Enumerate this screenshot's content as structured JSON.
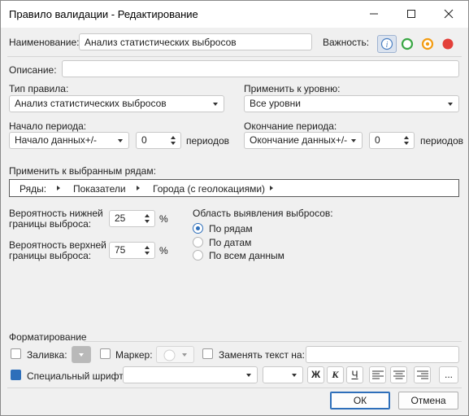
{
  "window": {
    "title": "Правило валидации - Редактирование"
  },
  "name": {
    "label": "Наименование:",
    "value": "Анализ статистических выбросов"
  },
  "importance": {
    "label": "Важность:",
    "options": [
      "info-icon",
      "green-circle-icon",
      "orange-circle-icon",
      "red-circle-icon"
    ],
    "colors": {
      "green": "#3aa745",
      "orange": "#f39c12",
      "red": "#e3403a",
      "info": "#4a7fc1"
    }
  },
  "description": {
    "label": "Описание:",
    "value": ""
  },
  "rule_type": {
    "label": "Тип правила:",
    "value": "Анализ статистических выбросов"
  },
  "apply_level": {
    "label": "Применить к уровню:",
    "value": "Все уровни"
  },
  "period_start": {
    "label": "Начало периода:",
    "mode": "Начало данных+/-",
    "count": "0",
    "unit": "периодов"
  },
  "period_end": {
    "label": "Окончание периода:",
    "mode": "Окончание данных+/-",
    "count": "0",
    "unit": "периодов"
  },
  "rows": {
    "label": "Применить к выбранным рядам:",
    "crumbs": [
      "Ряды:",
      "Показатели",
      "Города (с геолокациями)"
    ]
  },
  "lower": {
    "label_line1": "Вероятность нижней",
    "label_line2": "границы выброса:",
    "value": "25",
    "unit": "%"
  },
  "upper": {
    "label_line1": "Вероятность верхней",
    "label_line2": "границы выброса:",
    "value": "75",
    "unit": "%"
  },
  "scope": {
    "label": "Область выявления выбросов:",
    "options": [
      "По рядам",
      "По датам",
      "По всем данным"
    ],
    "selected": "По рядам"
  },
  "formatting": {
    "label": "Форматирование",
    "fill_label": "Заливка:",
    "marker_label": "Маркер:",
    "replace_label": "Заменять текст на:",
    "replace_value": "",
    "font_label": "Специальный шрифт:",
    "font_value": "",
    "size_value": "",
    "bold": "Ж",
    "italic": "К",
    "underline": "Ч",
    "more": "..."
  },
  "buttons": {
    "ok": "ОК",
    "cancel": "Отмена"
  }
}
